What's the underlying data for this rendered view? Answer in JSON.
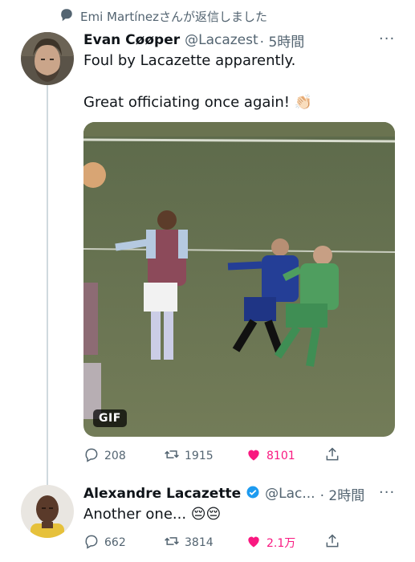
{
  "retweet_header": {
    "text": "Emi Martínezさんが返信しました"
  },
  "tweet1": {
    "name": "Evan Cøøper",
    "handle": "@Lacazest",
    "time": "· 5時間",
    "more": "···",
    "line1": "Foul by Lacazette apparently.",
    "line2": "Great officiating once again! 👏🏻",
    "media_badge": "GIF",
    "replies": "208",
    "retweets": "1915",
    "likes": "8101"
  },
  "tweet2": {
    "name": "Alexandre Lacazette",
    "handle": "@Lac...",
    "time": "· 2時間",
    "more": "···",
    "text": "Another one... 😔😔",
    "replies": "662",
    "retweets": "3814",
    "likes": "2.1万"
  },
  "colors": {
    "like": "#f91880",
    "verified": "#1d9bf0",
    "muted": "#536471"
  }
}
